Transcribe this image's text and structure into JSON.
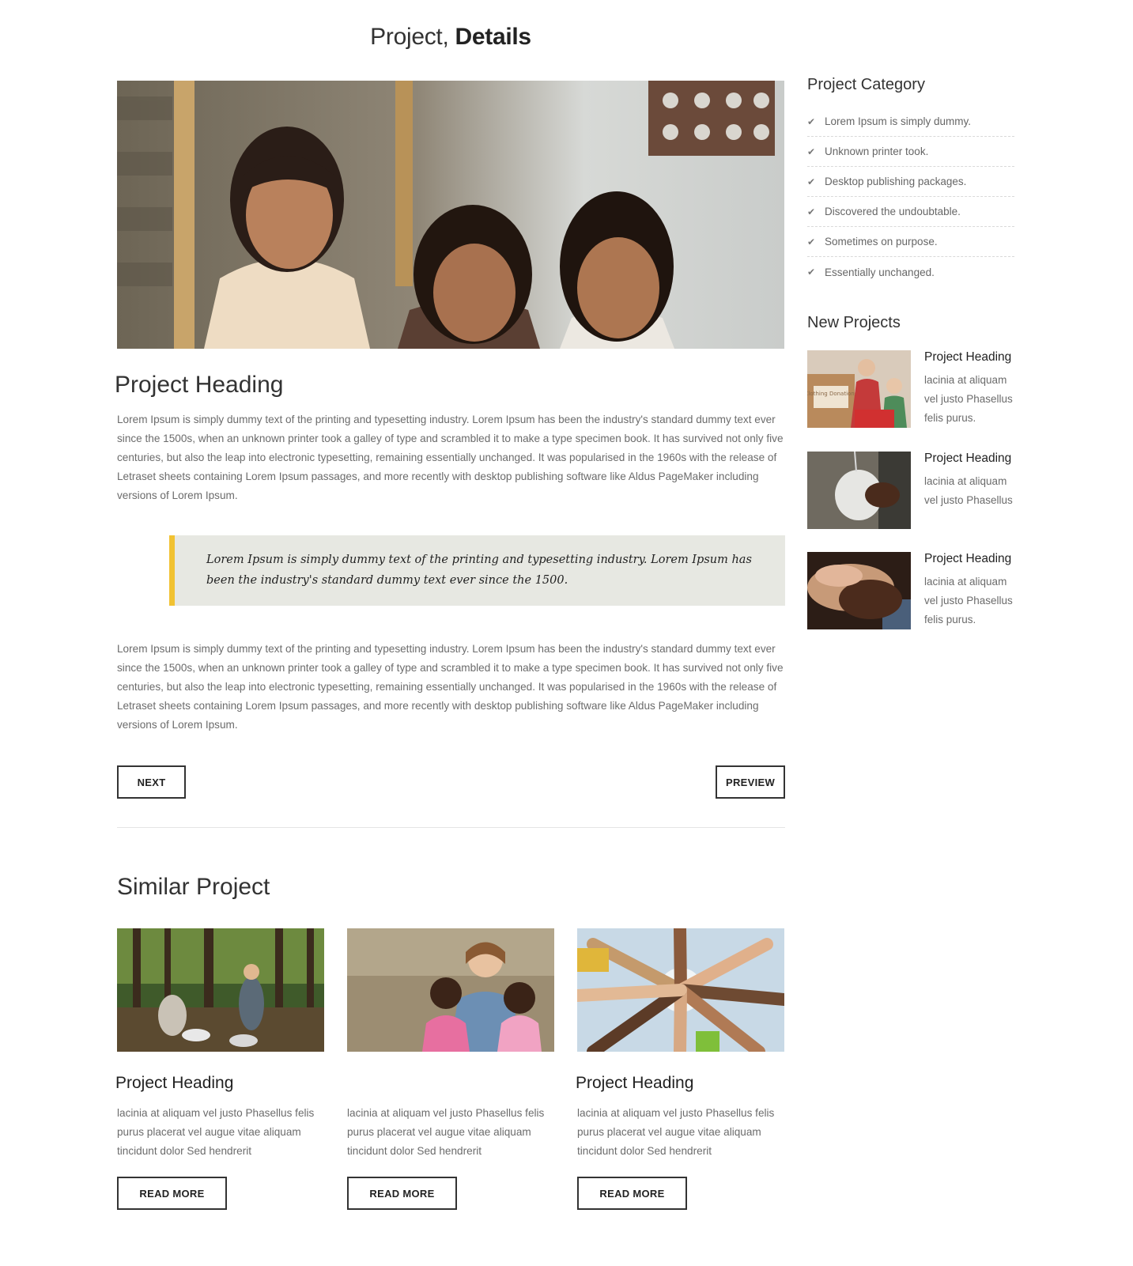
{
  "page_title": {
    "light": "Project,",
    "bold": "Details"
  },
  "main": {
    "heading": "Project Heading",
    "paragraph_1": "Lorem Ipsum is simply dummy text of the printing and typesetting industry. Lorem Ipsum has been the industry's standard dummy text ever since the 1500s, when an unknown printer took a galley of type and scrambled it to make a type specimen book. It has survived not only five centuries, but also the leap into electronic typesetting, remaining essentially unchanged. It was popularised in the 1960s with the release of Letraset sheets containing Lorem Ipsum passages, and more recently with desktop publishing software like Aldus PageMaker including versions of Lorem Ipsum.",
    "quote": "Lorem Ipsum is simply dummy text of the printing and typesetting industry. Lorem Ipsum has been the industry's standard dummy text ever since the 1500.",
    "paragraph_2": "Lorem Ipsum is simply dummy text of the printing and typesetting industry. Lorem Ipsum has been the industry's standard dummy text ever since the 1500s, when an unknown printer took a galley of type and scrambled it to make a type specimen book. It has survived not only five centuries, but also the leap into electronic typesetting, remaining essentially unchanged. It was popularised in the 1960s with the release of Letraset sheets containing Lorem Ipsum passages, and more recently with desktop publishing software like Aldus PageMaker including versions of Lorem Ipsum.",
    "next_label": "NEXT",
    "preview_label": "PREVIEW"
  },
  "similar": {
    "title": "Similar Project",
    "cards": [
      {
        "heading": "Project Heading",
        "text": "lacinia at aliquam vel justo Phasellus felis purus placerat vel augue vitae aliquam tincidunt dolor Sed hendrerit",
        "button": "READ MORE"
      },
      {
        "heading": "",
        "text": "lacinia at aliquam vel justo Phasellus felis purus placerat vel augue vitae aliquam tincidunt dolor Sed hendrerit",
        "button": "READ MORE"
      },
      {
        "heading": "Project Heading",
        "text": "lacinia at aliquam vel justo Phasellus felis purus placerat vel augue vitae aliquam tincidunt dolor Sed hendrerit",
        "button": "READ MORE"
      }
    ]
  },
  "sidebar": {
    "category_title": "Project Category",
    "categories": [
      "Lorem Ipsum is simply dummy.",
      "Unknown printer took.",
      "Desktop publishing packages.",
      "Discovered the undoubtable.",
      "Sometimes on purpose.",
      "Essentially unchanged."
    ],
    "new_projects_title": "New Projects",
    "new_projects": [
      {
        "heading": "Project Heading",
        "text": "lacinia at aliquam vel justo Phasellus felis purus."
      },
      {
        "heading": "Project Heading",
        "text": "lacinia at aliquam vel justo Phasellus"
      },
      {
        "heading": "Project Heading",
        "text": "lacinia at aliquam vel justo Phasellus felis purus."
      }
    ],
    "thumb_label": "Clothing Donations"
  },
  "colors": {
    "quote_bar": "#f1c232",
    "quote_bg": "#e7e8e2",
    "text": "#6b6b6b",
    "heading": "#333333"
  },
  "icons": {
    "category_bullet": "check-icon"
  }
}
